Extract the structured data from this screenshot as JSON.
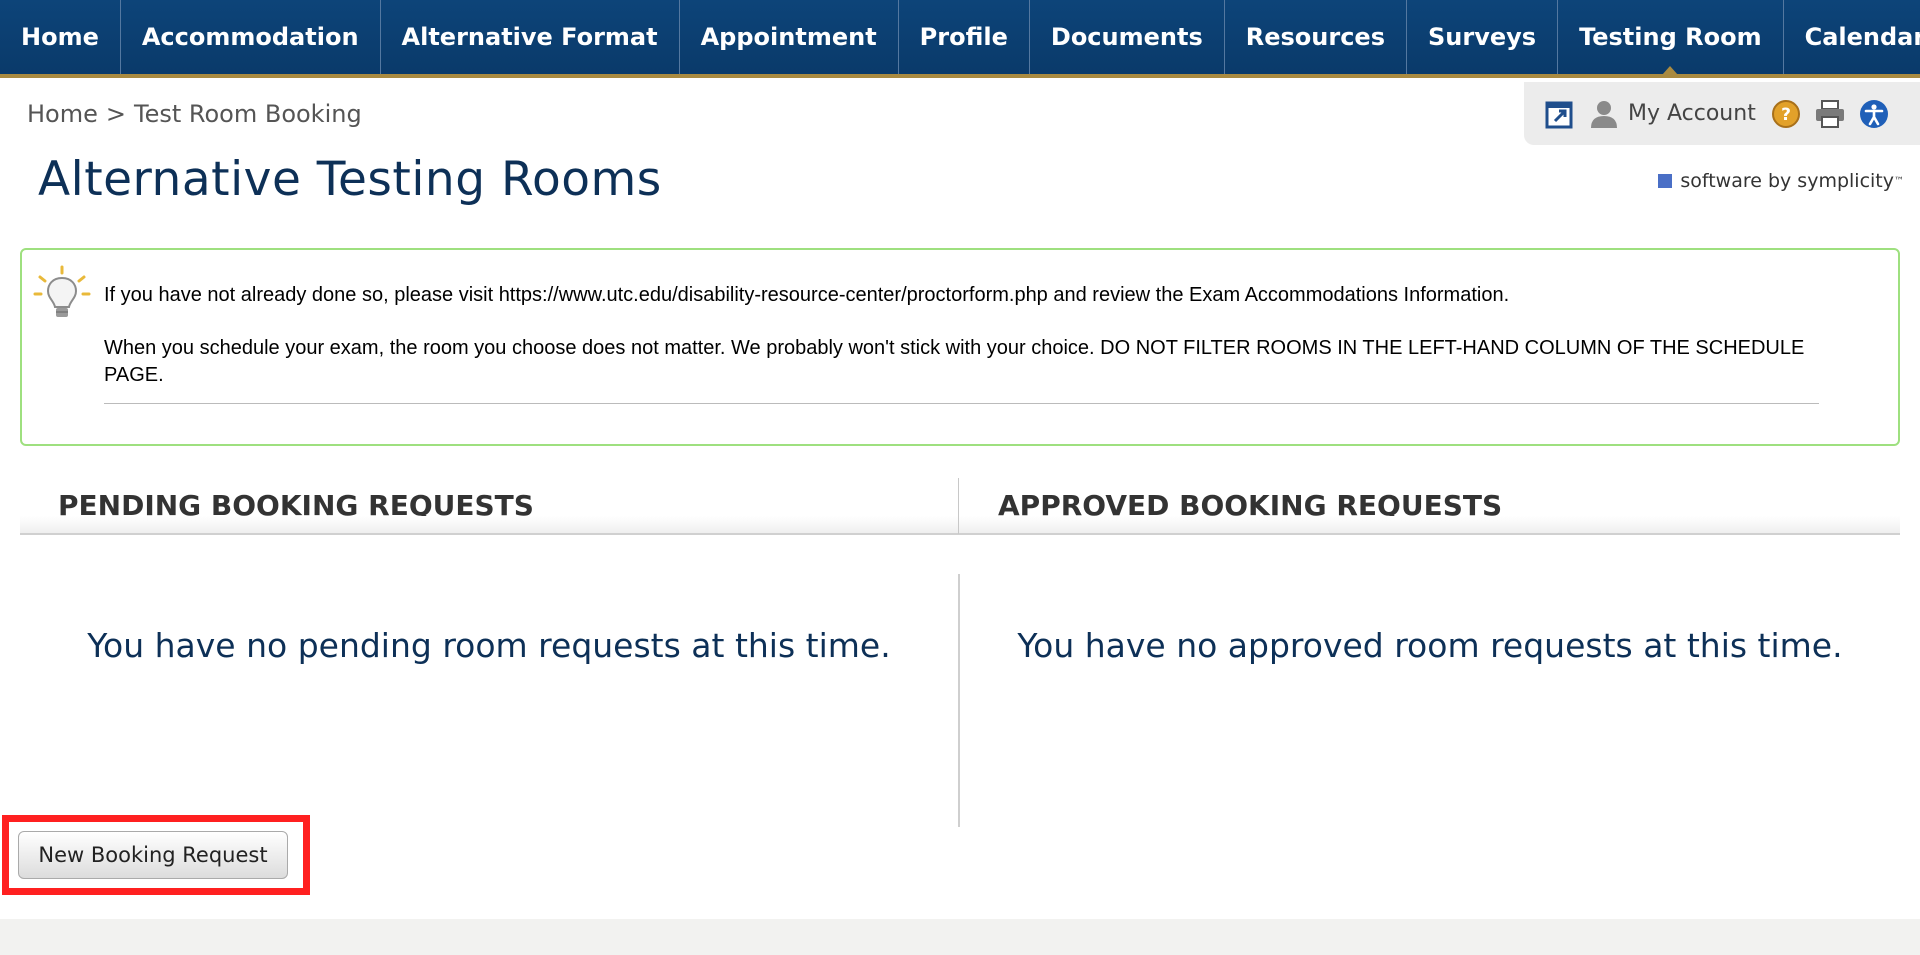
{
  "nav": {
    "items": [
      {
        "label": "Home",
        "name": "nav-home"
      },
      {
        "label": "Accommodation",
        "name": "nav-accommodation"
      },
      {
        "label": "Alternative Format",
        "name": "nav-alternative-format"
      },
      {
        "label": "Appointment",
        "name": "nav-appointment"
      },
      {
        "label": "Profile",
        "name": "nav-profile"
      },
      {
        "label": "Documents",
        "name": "nav-documents"
      },
      {
        "label": "Resources",
        "name": "nav-resources"
      },
      {
        "label": "Surveys",
        "name": "nav-surveys"
      },
      {
        "label": "Testing Room",
        "name": "nav-testing-room",
        "active": true
      },
      {
        "label": "Calendar",
        "name": "nav-calendar"
      }
    ]
  },
  "breadcrumb": {
    "home": "Home",
    "separator": ">",
    "current": "Test Room Booking"
  },
  "utility": {
    "my_account": "My Account",
    "icons": [
      "popout-icon",
      "user-icon",
      "help-icon",
      "print-icon",
      "accessibility-icon"
    ]
  },
  "page": {
    "title": "Alternative Testing Rooms",
    "vendor": "software by symplicity",
    "vendor_mark": "™"
  },
  "info": {
    "line1": "If you have not already done so, please visit https://www.utc.edu/disability-resource-center/proctorform.php and review the Exam Accommodations Information.",
    "line2": "When you schedule your exam, the room you choose does not matter. We probably won't stick with your choice. DO NOT FILTER ROOMS IN THE LEFT-HAND COLUMN OF THE SCHEDULE PAGE.",
    "icon": "lightbulb-icon"
  },
  "bookings": {
    "pending_heading": "PENDING BOOKING REQUESTS",
    "approved_heading": "APPROVED BOOKING REQUESTS",
    "pending_empty": "You have no pending room requests at this time.",
    "approved_empty": "You have no approved room requests at this time."
  },
  "actions": {
    "new_booking": "New Booking Request"
  },
  "colors": {
    "nav_bg": "#0d4479",
    "nav_accent": "#a98a40",
    "title": "#0d3057",
    "info_border": "#9ee07f",
    "highlight": "#ff2020"
  }
}
